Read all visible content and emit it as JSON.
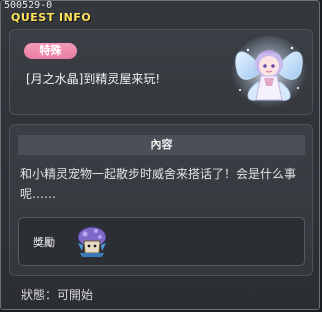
{
  "window": {
    "quest_id": "500529-0",
    "title": "QUEST INFO"
  },
  "quest": {
    "category_badge": "特殊",
    "title": "[月之水晶]到精灵屋来玩!",
    "portrait_icon": "fairy-npc-portrait-icon"
  },
  "content": {
    "header": "內容",
    "text": "和小精灵宠物一起散步时威舍来搭话了！会是什么事呢……"
  },
  "reward": {
    "label": "獎勵",
    "item_icon": "purple-mushroom-item-icon"
  },
  "status": {
    "text": "狀態：可開始"
  },
  "colors": {
    "title": "#ffe25a",
    "badge": "#ee8aae",
    "panel": "#3b3f45",
    "header": "#4b5058"
  }
}
